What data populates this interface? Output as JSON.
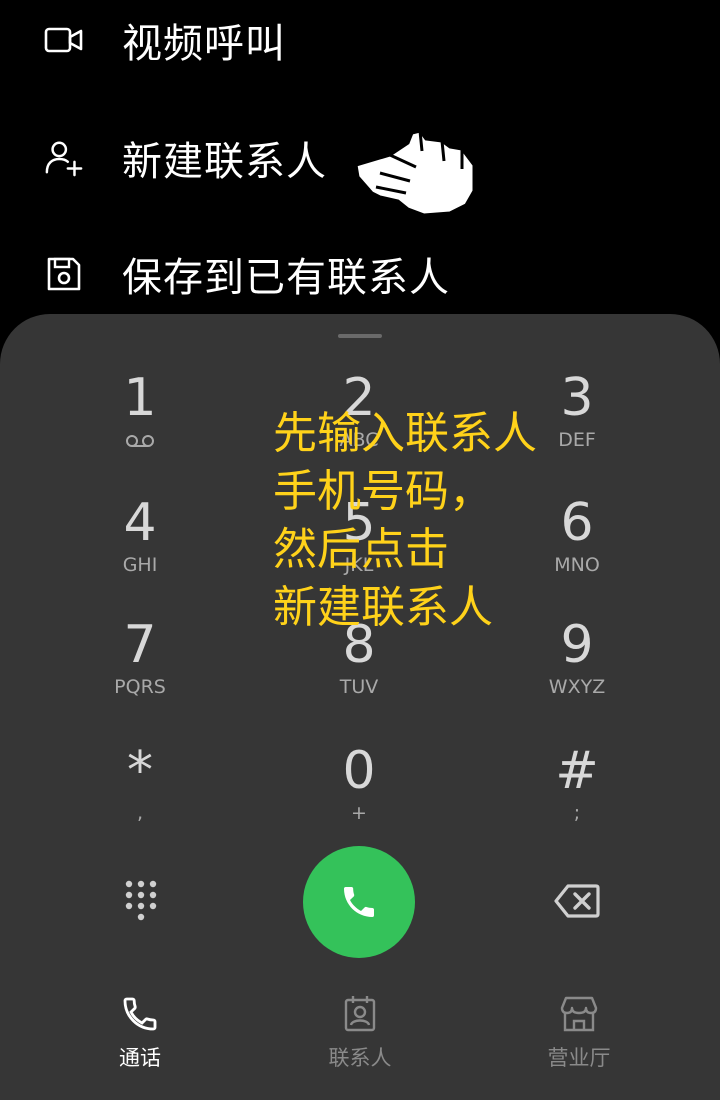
{
  "menu": {
    "items": [
      {
        "label": "视频呼叫",
        "icon": "video-camera-icon"
      },
      {
        "label": "新建联系人",
        "icon": "add-person-icon"
      },
      {
        "label": "保存到已有联系人",
        "icon": "save-disk-icon"
      }
    ]
  },
  "dialpad": {
    "keys": [
      {
        "digit": "1",
        "letters": "",
        "icon": "voicemail-icon"
      },
      {
        "digit": "2",
        "letters": "ABC"
      },
      {
        "digit": "3",
        "letters": "DEF"
      },
      {
        "digit": "4",
        "letters": "GHI"
      },
      {
        "digit": "5",
        "letters": "JKL"
      },
      {
        "digit": "6",
        "letters": "MNO"
      },
      {
        "digit": "7",
        "letters": "PQRS"
      },
      {
        "digit": "8",
        "letters": "TUV"
      },
      {
        "digit": "9",
        "letters": "WXYZ"
      },
      {
        "digit": "*",
        "letters": ","
      },
      {
        "digit": "0",
        "letters": "+"
      },
      {
        "digit": "#",
        "letters": ";"
      }
    ]
  },
  "actions": {
    "dialpad_toggle_icon": "dialpad-grid-icon",
    "call_icon": "phone-icon",
    "backspace_icon": "backspace-icon",
    "call_color": "#34c25a"
  },
  "nav": {
    "items": [
      {
        "label": "通话",
        "icon": "phone-icon",
        "active": true
      },
      {
        "label": "联系人",
        "icon": "contacts-book-icon",
        "active": false
      },
      {
        "label": "营业厅",
        "icon": "store-icon",
        "active": false
      }
    ],
    "active_color": "#ffffff",
    "inactive_color": "#8a8a8a"
  },
  "annotation": {
    "lines": [
      "先输入联系人",
      "手机号码，",
      "然后点击",
      "新建联系人"
    ],
    "color": "#ffd21a"
  }
}
